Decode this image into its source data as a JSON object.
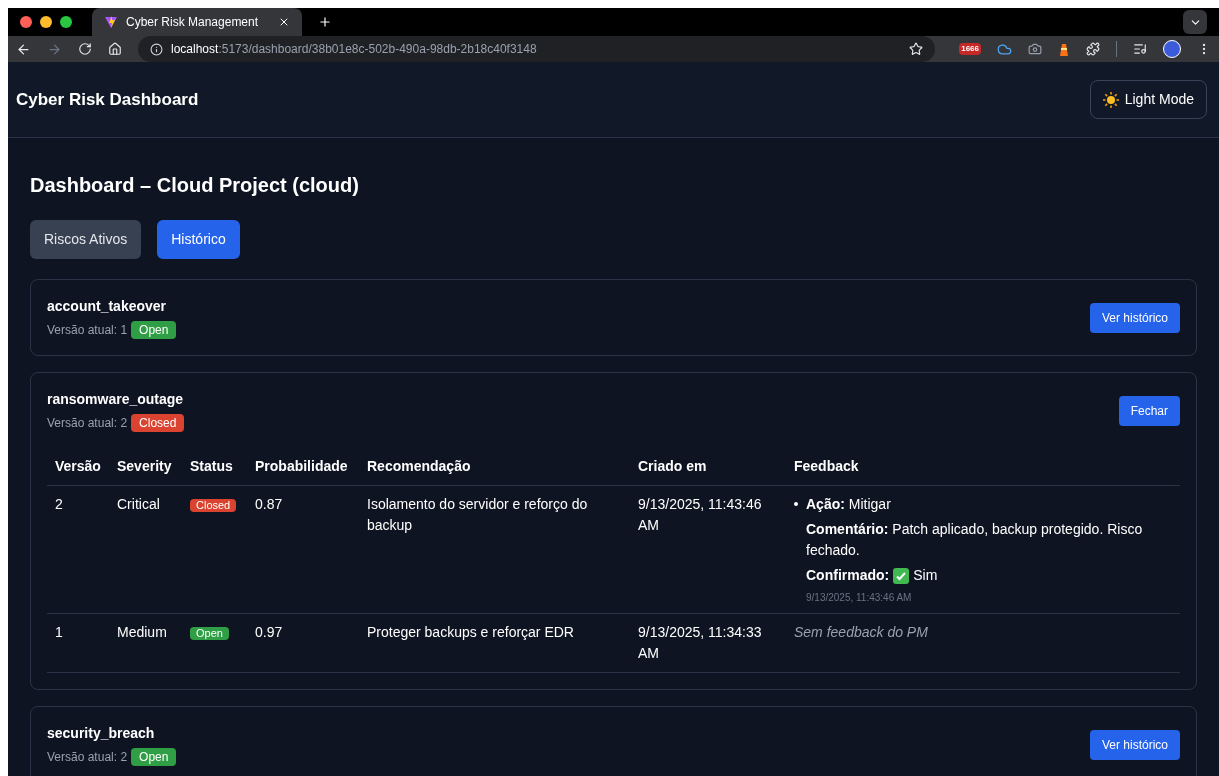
{
  "browser": {
    "tabs": [
      {
        "title": "Cyber Risk Management",
        "selected": true
      }
    ],
    "url": {
      "host": "localhost",
      "path": ":5173/dashboard/38b01e8c-502b-490a-98db-2b18c40f3148"
    },
    "extension_badge": "1666"
  },
  "header": {
    "title": "Cyber Risk Dashboard",
    "theme_button": "Light Mode"
  },
  "page": {
    "title": "Dashboard – Cloud Project (cloud)",
    "tabs": [
      {
        "label": "Riscos Ativos",
        "selected": false
      },
      {
        "label": "Histórico",
        "selected": true
      }
    ],
    "risks": [
      {
        "name": "account_takeover",
        "version": "Versão atual: 1",
        "status": {
          "label": "Open",
          "kind": "open"
        },
        "button": "Ver histórico"
      },
      {
        "name": "ransomware_outage",
        "version": "Versão atual: 2",
        "status": {
          "label": "Closed",
          "kind": "closed"
        },
        "button": "Fechar",
        "table": {
          "columns": [
            "Versão",
            "Severity",
            "Status",
            "Probabilidade",
            "Recomendação",
            "Criado em",
            "Feedback"
          ],
          "rows": [
            {
              "version": "2",
              "severity": "Critical",
              "status": {
                "label": "Closed",
                "kind": "closed"
              },
              "probability": "0.87",
              "recommendation": "Isolamento do servidor e reforço do backup",
              "created": "9/13/2025, 11:43:46 AM",
              "feedback": {
                "kind": "full",
                "action_label": "Ação:",
                "action": "Mitigar",
                "comment_label": "Comentário:",
                "comment": "Patch aplicado, backup protegido. Risco fechado.",
                "confirmed_label": "Confirmado:",
                "confirmed": true,
                "confirmed_value": "Sim",
                "timestamp": "9/13/2025, 11:43:46 AM"
              }
            },
            {
              "version": "1",
              "severity": "Medium",
              "status": {
                "label": "Open",
                "kind": "open"
              },
              "probability": "0.97",
              "recommendation": "Proteger backups e reforçar EDR",
              "created": "9/13/2025, 11:34:33 AM",
              "feedback": {
                "kind": "none",
                "text": "Sem feedback do PM"
              }
            }
          ]
        }
      },
      {
        "name": "security_breach",
        "version": "Versão atual: 2",
        "status": {
          "label": "Open",
          "kind": "open"
        },
        "button": "Ver histórico"
      }
    ]
  }
}
